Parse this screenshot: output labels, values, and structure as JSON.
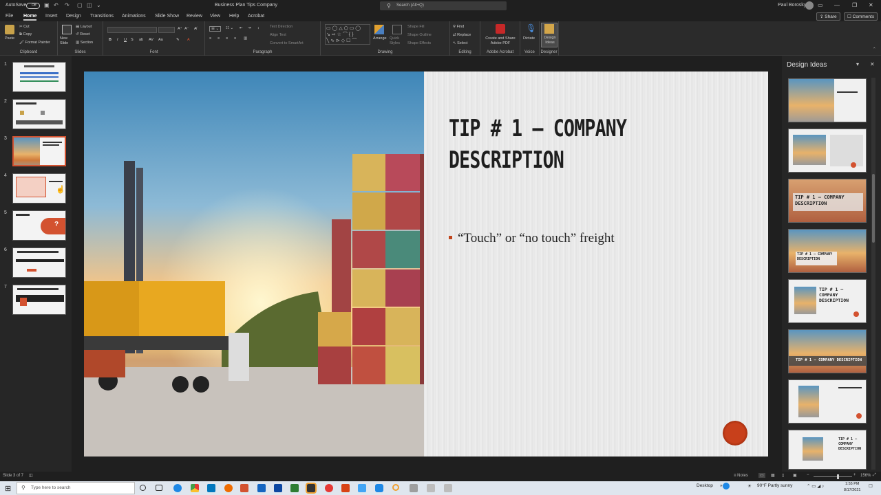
{
  "titlebar": {
    "autosave_label": "AutoSave",
    "autosave_state": "Off",
    "doc_title": "Business Plan Tips Company",
    "search_placeholder": "Search (Alt+Q)",
    "user_name": "Paul Borosky"
  },
  "tabs": [
    {
      "label": "File"
    },
    {
      "label": "Home"
    },
    {
      "label": "Insert"
    },
    {
      "label": "Design"
    },
    {
      "label": "Transitions"
    },
    {
      "label": "Animations"
    },
    {
      "label": "Slide Show"
    },
    {
      "label": "Review"
    },
    {
      "label": "View"
    },
    {
      "label": "Help"
    },
    {
      "label": "Acrobat"
    }
  ],
  "active_tab": "Home",
  "share_label": "Share",
  "comments_label": "Comments",
  "ribbon": {
    "clipboard": {
      "paste": "Paste",
      "cut": "Cut",
      "copy": "Copy",
      "format_painter": "Format Painter",
      "label": "Clipboard"
    },
    "slides": {
      "new_slide": "New Slide",
      "layout": "Layout",
      "reset": "Reset",
      "section": "Section",
      "label": "Slides"
    },
    "font": {
      "label": "Font"
    },
    "paragraph": {
      "text_direction": "Text Direction",
      "align_text": "Align Text",
      "convert_smartart": "Convert to SmartArt",
      "label": "Paragraph"
    },
    "drawing": {
      "arrange": "Arrange",
      "quick_styles": "Quick Styles",
      "shape_fill": "Shape Fill",
      "shape_outline": "Shape Outline",
      "shape_effects": "Shape Effects",
      "label": "Drawing"
    },
    "editing": {
      "find": "Find",
      "replace": "Replace",
      "select": "Select",
      "label": "Editing"
    },
    "acrobat": {
      "create_share": "Create and Share Adobe PDF",
      "label": "Adobe Acrobat"
    },
    "voice": {
      "dictate": "Dictate",
      "label": "Voice"
    },
    "designer": {
      "design_ideas": "Design Ideas",
      "label": "Designer"
    }
  },
  "slide_thumbs": [
    {
      "num": "1"
    },
    {
      "num": "2"
    },
    {
      "num": "3"
    },
    {
      "num": "4"
    },
    {
      "num": "5"
    },
    {
      "num": "6"
    },
    {
      "num": "7"
    }
  ],
  "selected_slide": 3,
  "slide": {
    "title": "TIP # 1 – COMPANY DESCRIPTION",
    "bullet": "“Touch” or “no touch” freight"
  },
  "design_panel": {
    "title": "Design Ideas",
    "thumbs": [
      {
        "caption": ""
      },
      {
        "caption": ""
      },
      {
        "caption": "TIP # 1 – COMPANY DESCRIPTION"
      },
      {
        "caption": "TIP # 1 – COMPANY DESCRIPTION"
      },
      {
        "caption": "TIP # 1 – COMPANY DESCRIPTION"
      },
      {
        "caption": "TIP # 1 – COMPANY DESCRIPTION"
      },
      {
        "caption": ""
      },
      {
        "caption": "TIP # 1 – COMPANY DESCRIPTION"
      }
    ]
  },
  "statusbar": {
    "slide_info": "Slide 3 of 7",
    "notes": "Notes",
    "zoom": "156%"
  },
  "taskbar": {
    "search_placeholder": "Type here to search",
    "desktop_label": "Desktop",
    "weather": "90°F  Partly sunny",
    "time": "1:55 PM",
    "date": "8/17/2021"
  },
  "colors": {
    "accent": "#d35230",
    "bullet": "#c0451c",
    "dark_bg": "#1f1f1f",
    "ribbon_bg": "#2b2b2b"
  }
}
